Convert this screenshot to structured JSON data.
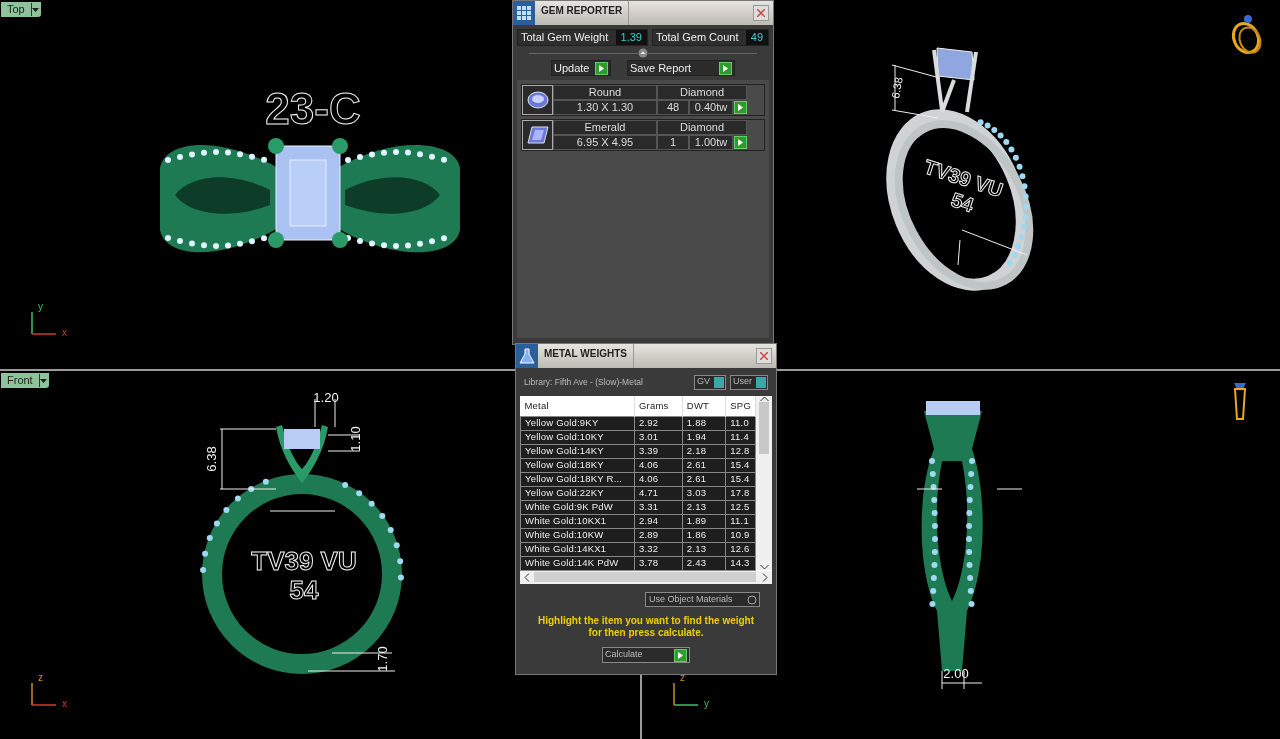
{
  "viewports": [
    {
      "kind": "top",
      "label": "Top",
      "texts": [
        "23-C"
      ],
      "axes": [
        "y",
        "x"
      ]
    },
    {
      "kind": "perspective",
      "texts": [
        "6.38",
        "TV39 VU",
        "54"
      ]
    },
    {
      "kind": "front",
      "label": "Front",
      "texts": [
        "1.20",
        "6.38",
        "1.10",
        "TV39 VU",
        "54",
        "1.70"
      ],
      "axes": [
        "z",
        "x"
      ]
    },
    {
      "kind": "right",
      "texts": [
        "2.00"
      ],
      "axes": [
        "z",
        "y"
      ]
    }
  ],
  "gem_reporter": {
    "title": "GEM REPORTER",
    "totals": [
      {
        "label": "Total Gem Weight",
        "value": "1.39"
      },
      {
        "label": "Total Gem Count",
        "value": "49"
      }
    ],
    "buttons": [
      "Update",
      "Save Report"
    ],
    "gems": [
      {
        "kind": "round",
        "shape": "Round",
        "size": "1.30 X 1.30",
        "type": "Diamond",
        "count": "48",
        "weight": "0.40tw"
      },
      {
        "kind": "emerald",
        "shape": "Emerald",
        "size": "6.95 X 4.95",
        "type": "Diamond",
        "count": "1",
        "weight": "1.00tw"
      }
    ]
  },
  "metal_weights": {
    "title": "METAL WEIGHTS",
    "library": "Library: Fifth Ave - (Slow)-Metal",
    "toggles": [
      "GV",
      "User"
    ],
    "columns": [
      "Metal",
      "Grams",
      "DWT",
      "SPG"
    ],
    "rows": [
      [
        "Yellow Gold:9KY",
        "2.92",
        "1.88",
        "11.0"
      ],
      [
        "Yellow Gold:10KY",
        "3.01",
        "1.94",
        "11.4"
      ],
      [
        "Yellow Gold:14KY",
        "3.39",
        "2.18",
        "12.8"
      ],
      [
        "Yellow Gold:18KY",
        "4.06",
        "2.61",
        "15.4"
      ],
      [
        "Yellow Gold:18KY R...",
        "4.06",
        "2.61",
        "15.4"
      ],
      [
        "Yellow Gold:22KY",
        "4.71",
        "3.03",
        "17.8"
      ],
      [
        "White Gold:9K PdW",
        "3.31",
        "2.13",
        "12.5"
      ],
      [
        "White Gold:10KX1",
        "2.94",
        "1.89",
        "11.1"
      ],
      [
        "White Gold:10KW",
        "2.89",
        "1.86",
        "10.9"
      ],
      [
        "White Gold:14KX1",
        "3.32",
        "2.13",
        "12.6"
      ],
      [
        "White Gold:14K PdW",
        "3.78",
        "2.43",
        "14.3"
      ]
    ],
    "option": {
      "label": "Use Object Materials",
      "checked": false
    },
    "message": "Highlight the item you want to find the weight for then press calculate.",
    "action": "Calculate"
  }
}
